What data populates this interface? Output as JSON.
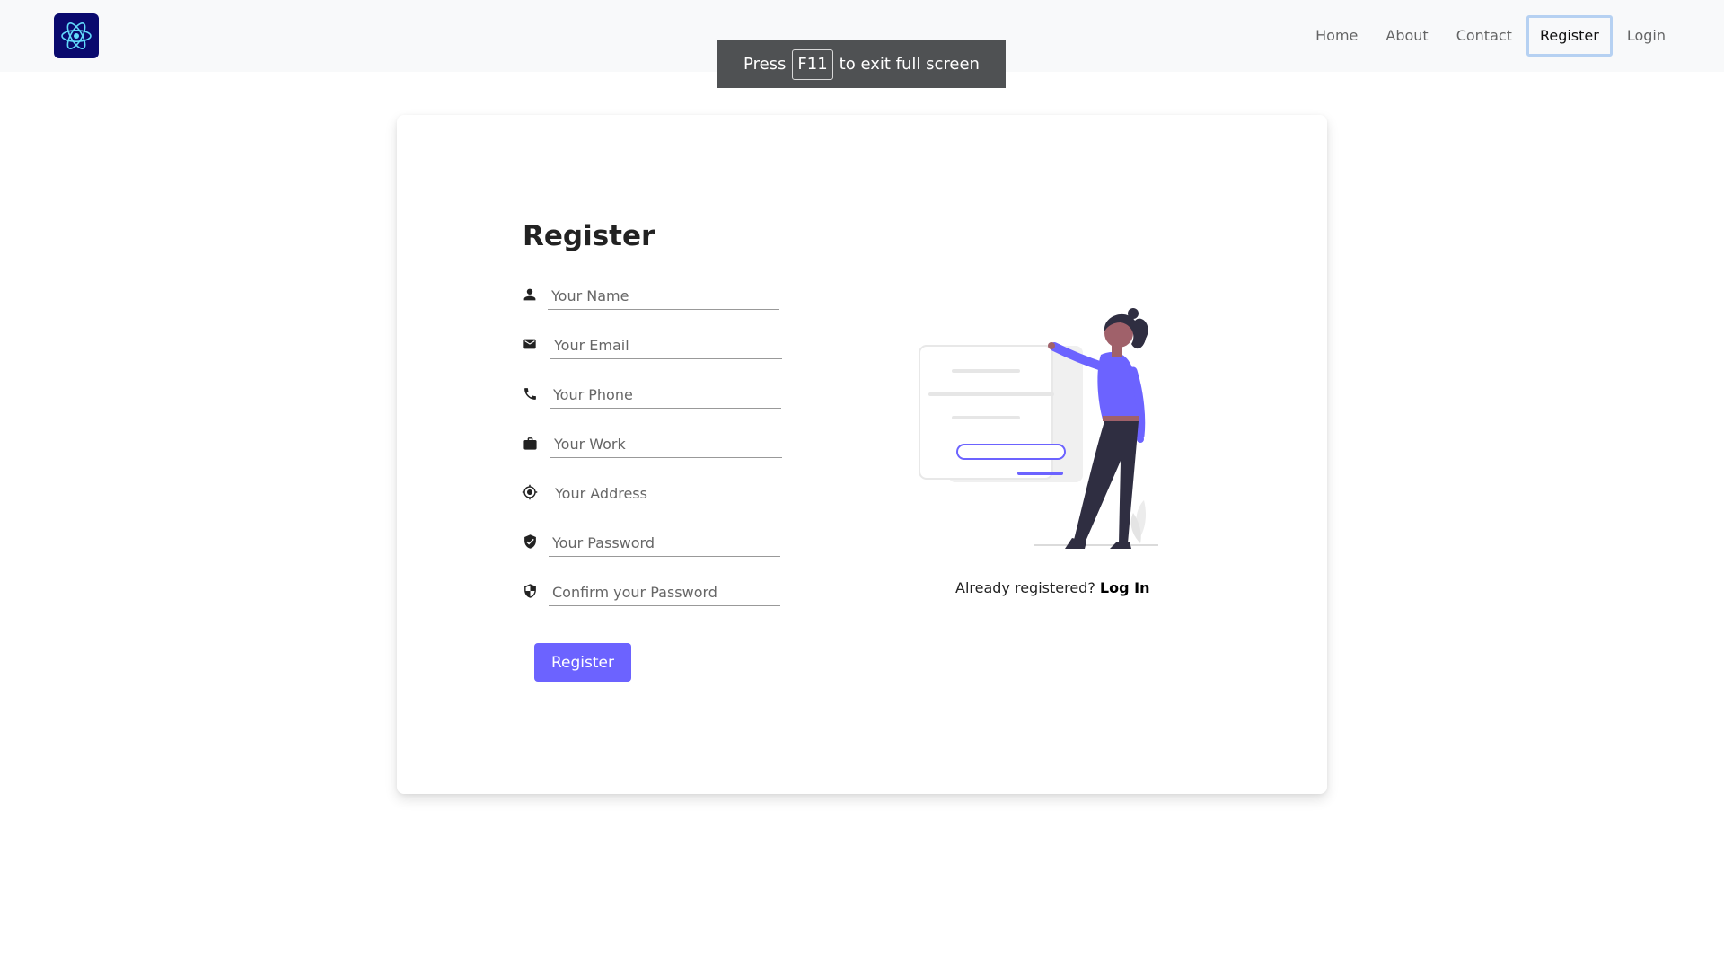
{
  "nav": {
    "brand_icon": "react-atom-logo",
    "links": [
      {
        "label": "Home"
      },
      {
        "label": "About"
      },
      {
        "label": "Contact"
      },
      {
        "label": "Register"
      },
      {
        "label": "Login"
      }
    ],
    "active": "Register"
  },
  "fullscreen_toast": {
    "prefix": "Press",
    "key": "F11",
    "suffix": "to exit full screen"
  },
  "register": {
    "title": "Register",
    "fields": [
      {
        "icon": "person-icon",
        "placeholder": "Your Name"
      },
      {
        "icon": "mail-icon",
        "placeholder": "Your Email"
      },
      {
        "icon": "phone-icon",
        "placeholder": "Your Phone"
      },
      {
        "icon": "briefcase-icon",
        "placeholder": "Your Work"
      },
      {
        "icon": "location-icon",
        "placeholder": "Your Address"
      },
      {
        "icon": "shield-check-icon",
        "placeholder": "Your Password"
      },
      {
        "icon": "shield-half-icon",
        "placeholder": "Confirm your Password"
      }
    ],
    "submit_label": "Register",
    "signin_prompt": "Already registered?",
    "signin_link": "Log In"
  },
  "colors": {
    "accent": "#6c63ff",
    "navbar_bg": "#f8f9fa",
    "brand_bg": "#0a0a6e",
    "toast_bg": "#4f5153"
  }
}
